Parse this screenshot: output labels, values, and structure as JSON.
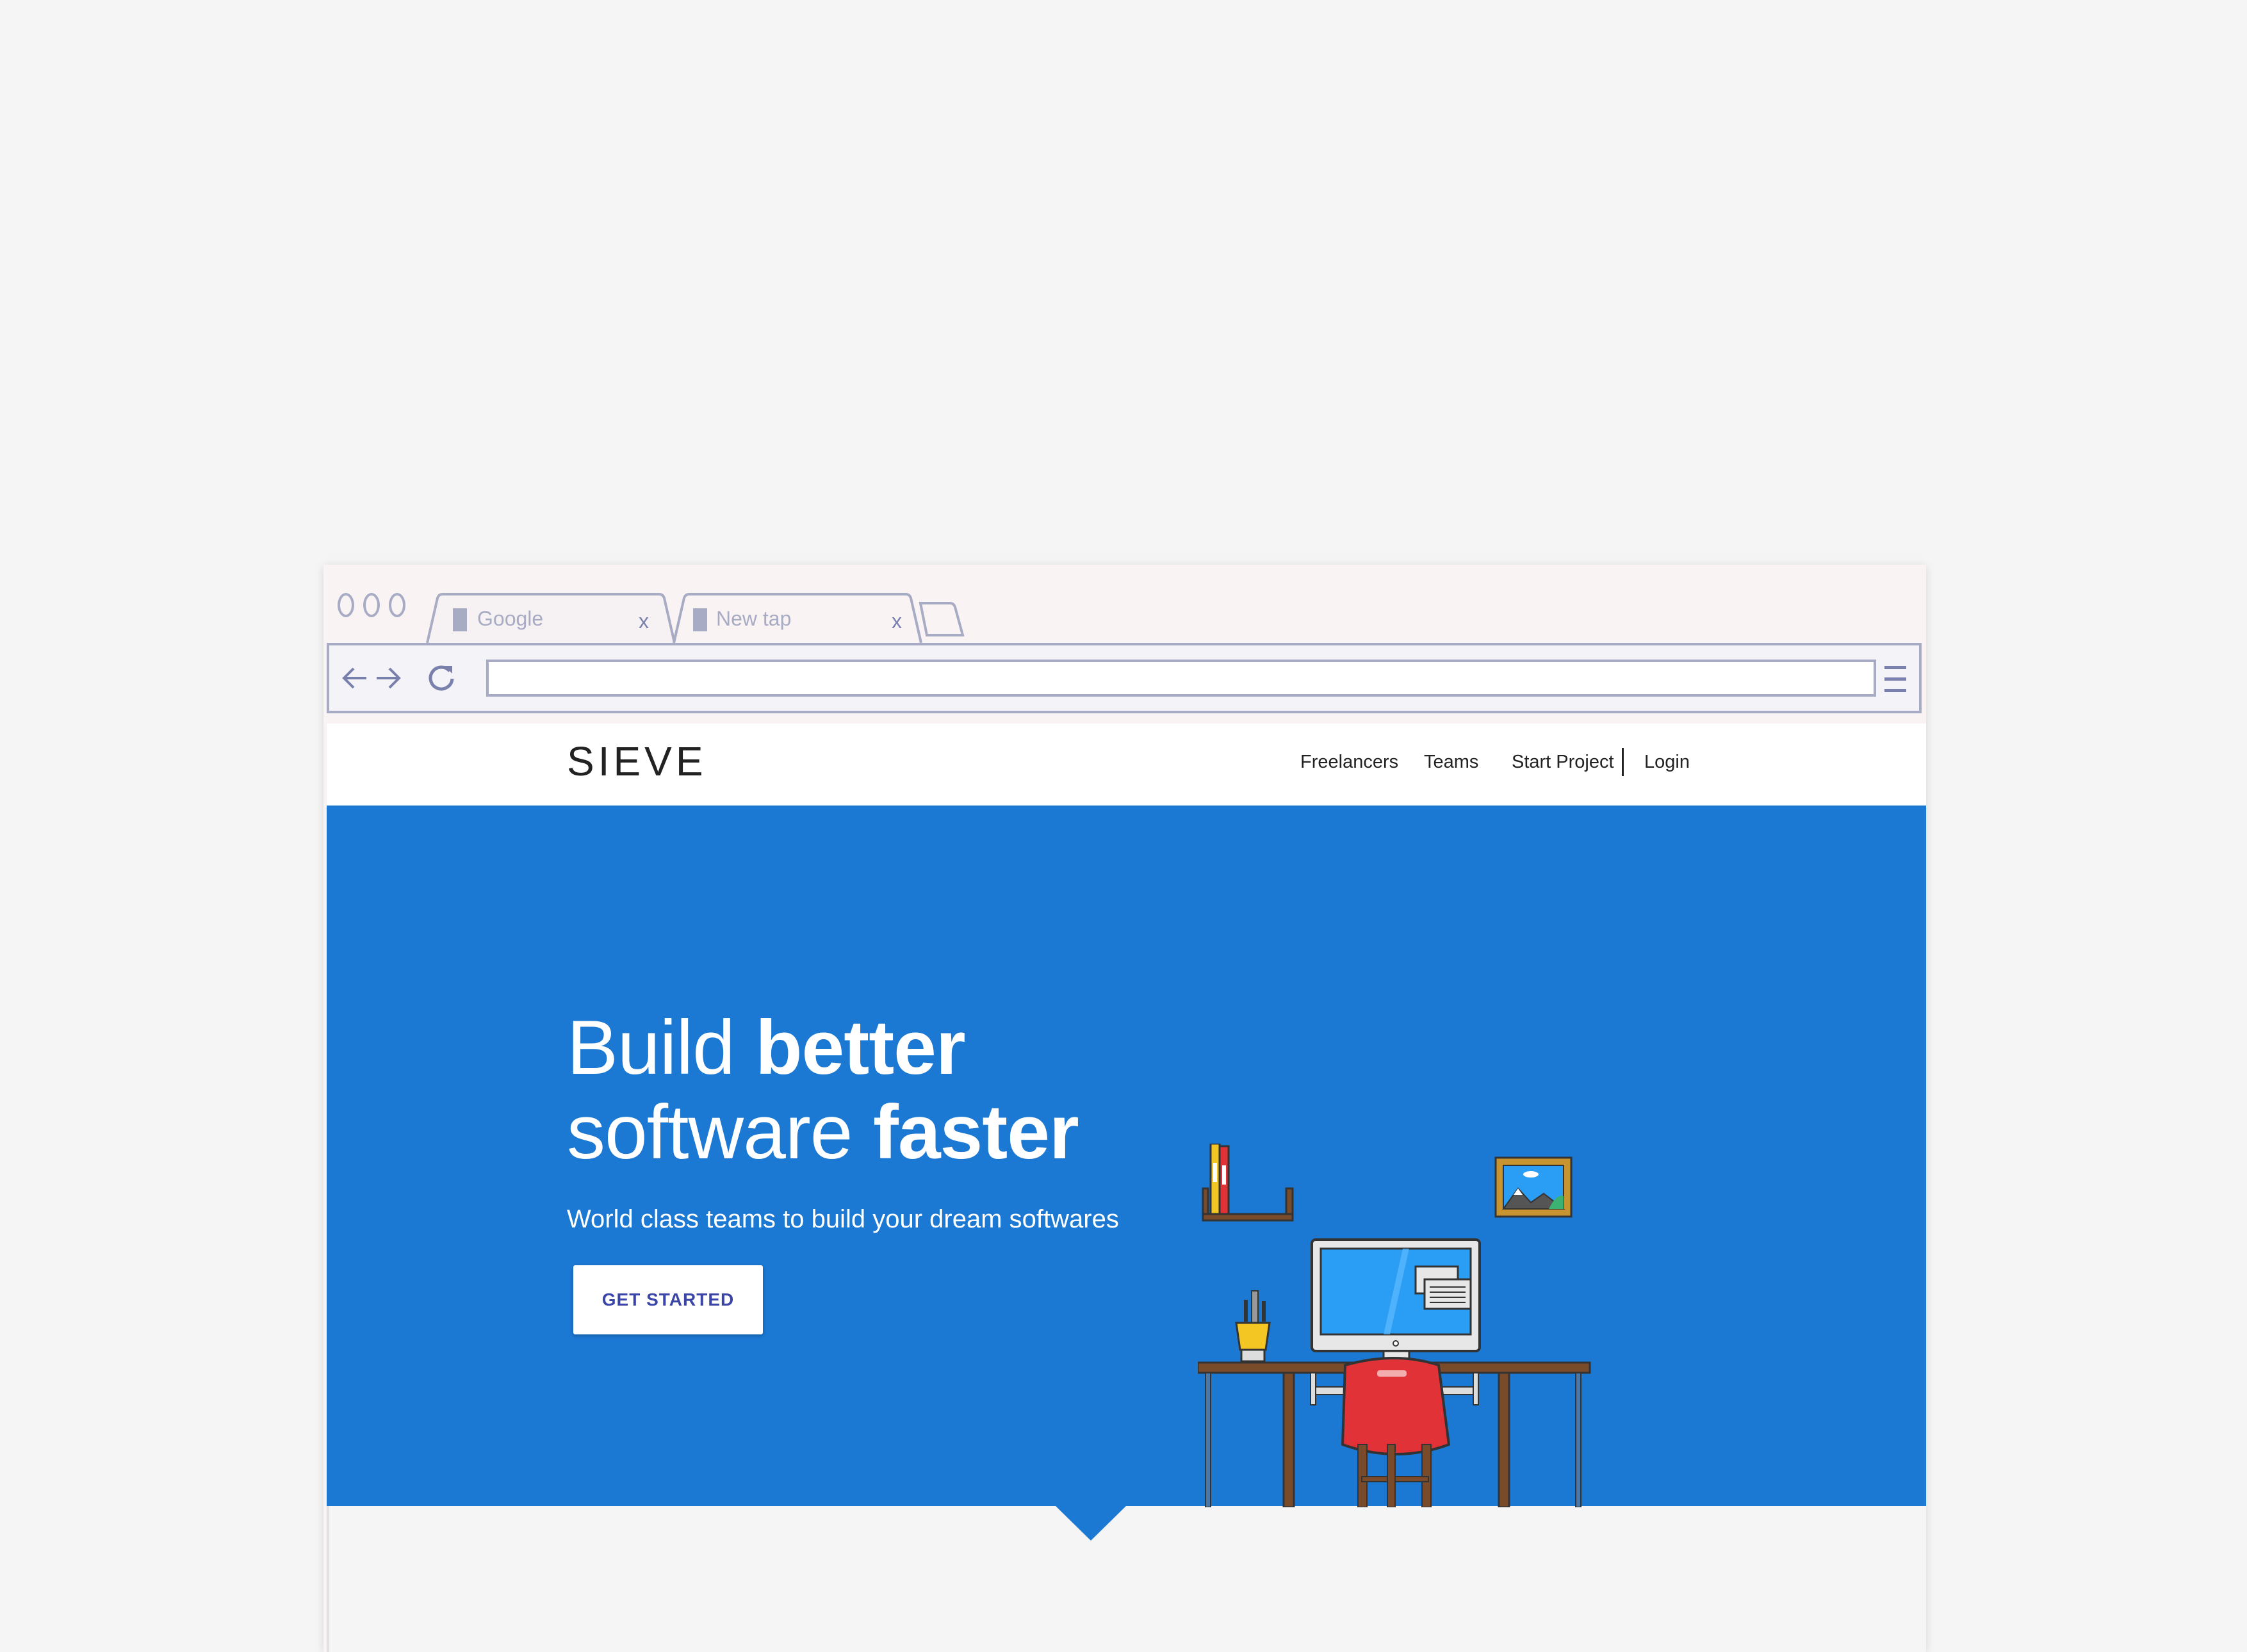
{
  "browser": {
    "tabs": [
      {
        "label": "Google",
        "close": "x"
      },
      {
        "label": "New tap",
        "close": "x"
      }
    ],
    "address_value": ""
  },
  "site": {
    "logo": "SIEVE",
    "nav": {
      "freelancers": "Freelancers",
      "teams": "Teams",
      "start_project": "Start Project",
      "login": "Login"
    },
    "hero": {
      "headline_line1_light": "Build ",
      "headline_line1_bold": "better",
      "headline_line2_light": "software ",
      "headline_line2_bold": "faster",
      "subtitle": "World class teams to build your dream softwares",
      "cta_label": "GET STARTED"
    }
  },
  "colors": {
    "hero_bg": "#1b78d3",
    "chrome_line": "#a8abc4",
    "cta_text": "#3b45a8",
    "chair": "#e03237"
  },
  "icons": [
    "back-arrow-icon",
    "forward-arrow-icon",
    "reload-icon",
    "hamburger-menu-icon",
    "tab-favicon-icon",
    "new-tab-icon"
  ]
}
